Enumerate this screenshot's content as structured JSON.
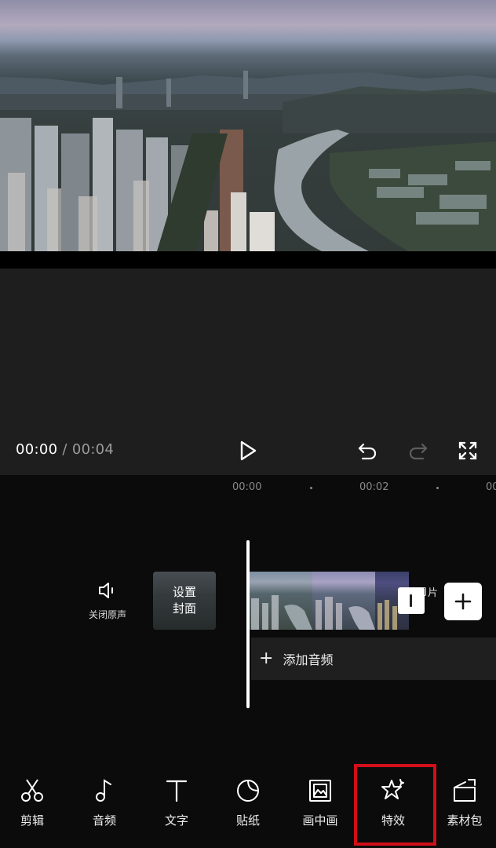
{
  "player": {
    "current_time": "00:00",
    "separator": "/",
    "total_time": "00:04"
  },
  "timeline": {
    "ruler": [
      "00:00",
      "00:02",
      "00"
    ],
    "mute_label": "关闭原声",
    "cover_label_line1": "设置",
    "cover_label_line2": "封面",
    "end_label": "片",
    "add_audio_label": "添加音频"
  },
  "toolbar": {
    "items": [
      {
        "label": "剪辑",
        "icon": "scissors-icon"
      },
      {
        "label": "音频",
        "icon": "music-note-icon"
      },
      {
        "label": "文字",
        "icon": "text-icon"
      },
      {
        "label": "贴纸",
        "icon": "sticker-icon"
      },
      {
        "label": "画中画",
        "icon": "picture-in-picture-icon"
      },
      {
        "label": "特效",
        "icon": "effects-star-icon"
      },
      {
        "label": "素材包",
        "icon": "material-pack-icon"
      }
    ],
    "highlighted": "特效",
    "highlight_color": "#d10f1a"
  }
}
